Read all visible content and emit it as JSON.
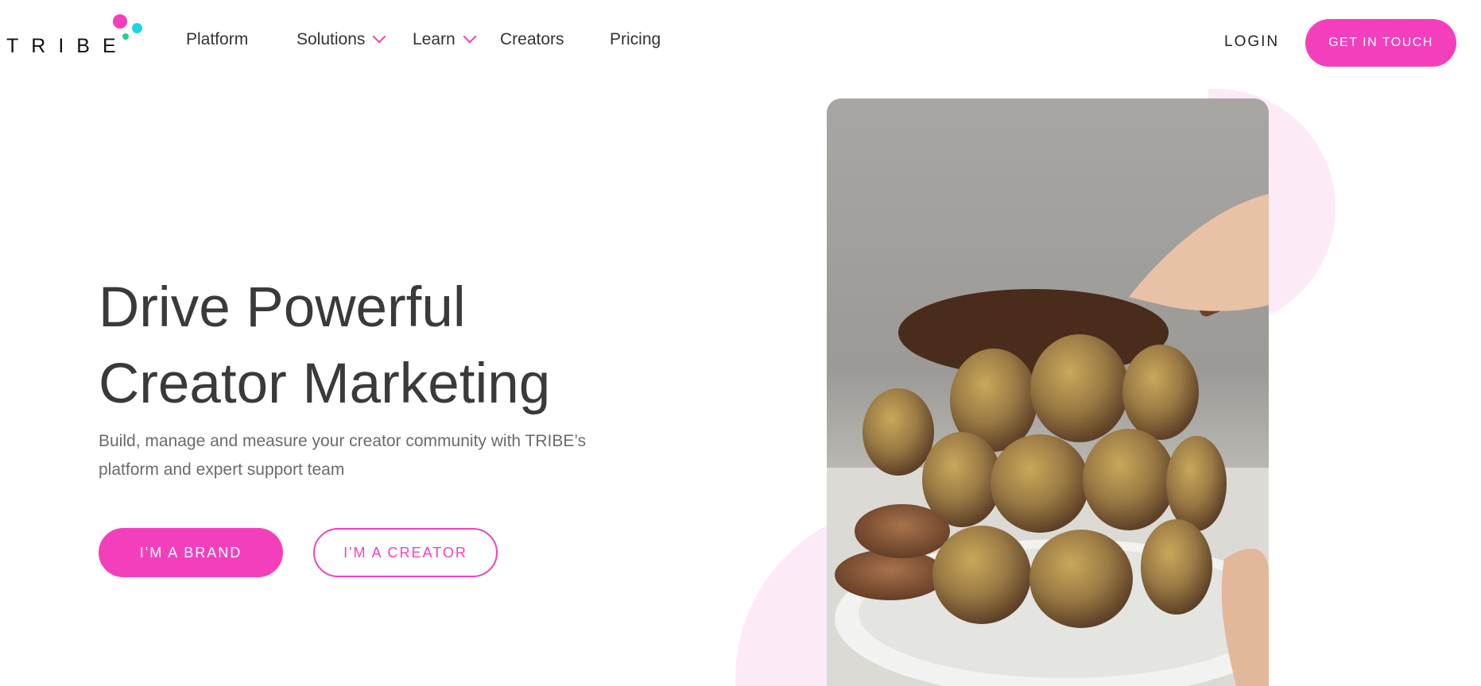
{
  "brand": {
    "name": "TRIBE",
    "accent": "#f43fbd",
    "dot_colors": [
      "#f03ebc",
      "#19d6e6",
      "#18d498"
    ]
  },
  "nav": {
    "items": [
      {
        "label": "Platform",
        "dropdown": false
      },
      {
        "label": "Solutions",
        "dropdown": true
      },
      {
        "label": "Learn",
        "dropdown": true
      },
      {
        "label": "Creators",
        "dropdown": false
      },
      {
        "label": "Pricing",
        "dropdown": false
      }
    ],
    "login_label": "LOGIN",
    "cta_label": "GET IN TOUCH"
  },
  "hero": {
    "headline_line1": "Drive Powerful",
    "headline_line2": "Creator Marketing",
    "subtext_line1": "Build, manage and measure your creator community with TRIBE’s",
    "subtext_line2": "platform and expert support team",
    "brand_button": "I'M A BRAND",
    "creator_button": "I'M A CREATOR"
  }
}
